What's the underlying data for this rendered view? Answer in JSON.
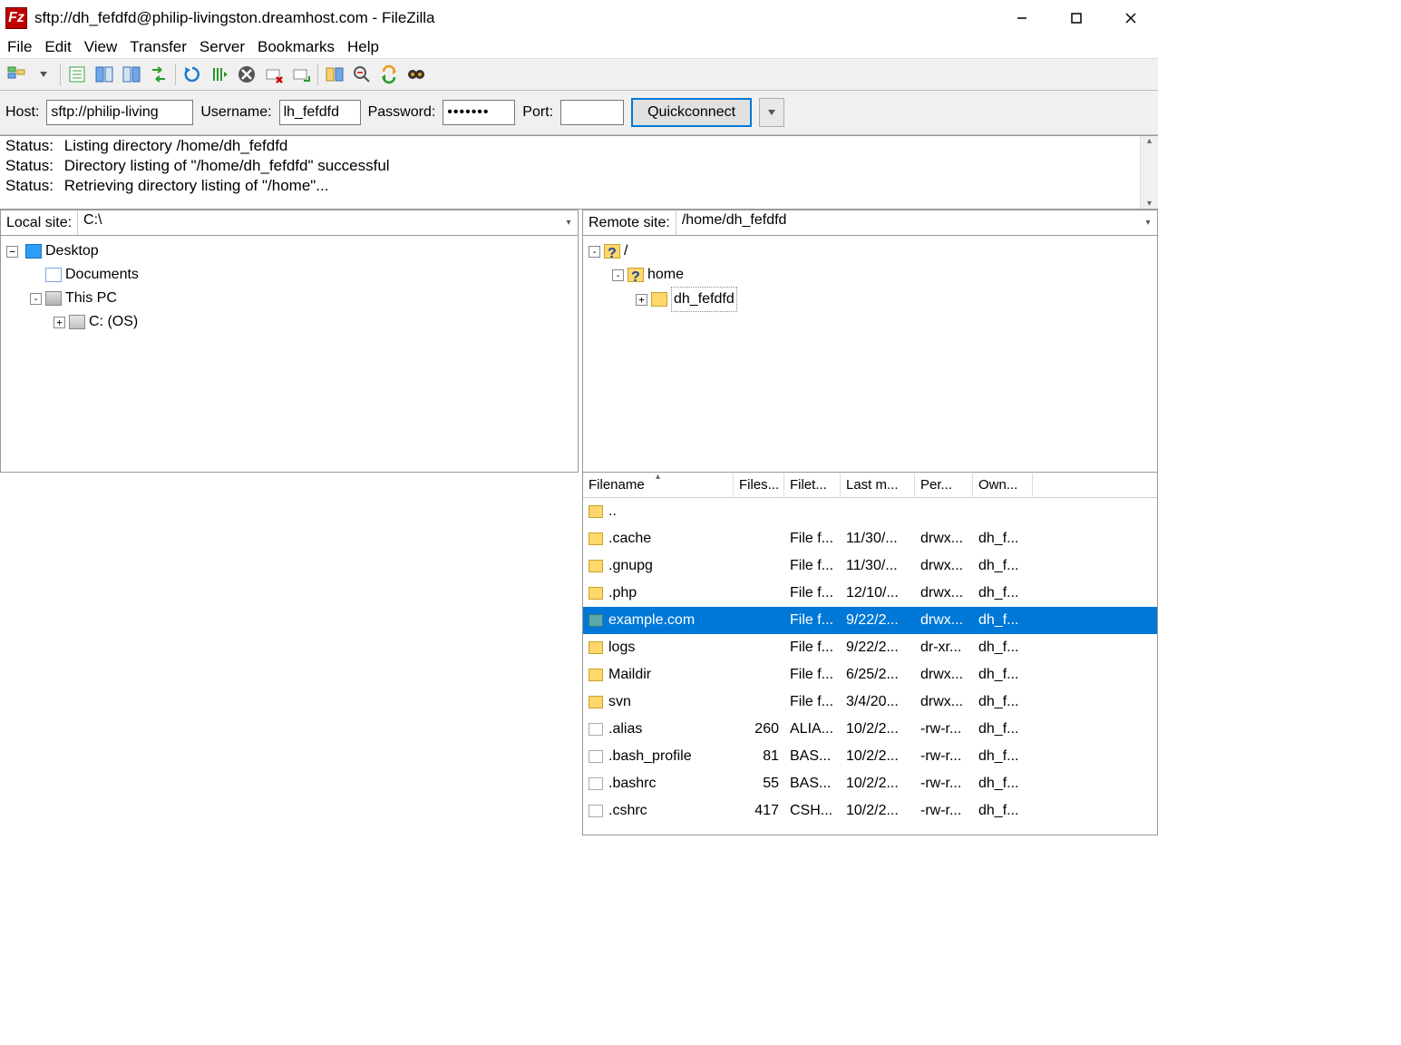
{
  "window": {
    "title": "sftp://dh_fefdfd@philip-livingston.dreamhost.com - FileZilla"
  },
  "menu": {
    "items": [
      "File",
      "Edit",
      "View",
      "Transfer",
      "Server",
      "Bookmarks",
      "Help"
    ]
  },
  "toolbar_icons": [
    "site-manager-icon",
    "dropdown-icon",
    "__sep",
    "toggle-log-icon",
    "toggle-local-tree-icon",
    "toggle-remote-tree-icon",
    "toggle-queue-icon",
    "__sep",
    "refresh-icon",
    "process-queue-icon",
    "cancel-icon",
    "disconnect-icon",
    "reconnect-icon",
    "__sep",
    "compare-icon",
    "filter-icon",
    "sync-browse-icon",
    "search-icon"
  ],
  "quickconnect": {
    "host_label": "Host:",
    "host_value": "sftp://philip-living",
    "user_label": "Username:",
    "user_value": "lh_fefdfd",
    "pass_label": "Password:",
    "pass_value": "•••••••",
    "port_label": "Port:",
    "port_value": "",
    "button": "Quickconnect"
  },
  "log": {
    "status_label": "Status:",
    "lines": [
      "Listing directory /home/dh_fefdfd",
      "Directory listing of \"/home/dh_fefdfd\" successful",
      "Retrieving directory listing of \"/home\"..."
    ]
  },
  "local": {
    "label": "Local site:",
    "path": "C:\\",
    "tree": {
      "desktop": "Desktop",
      "documents": "Documents",
      "thispc": "This PC",
      "drive": "C: (OS)"
    }
  },
  "remote": {
    "label": "Remote site:",
    "path": "/home/dh_fefdfd",
    "tree": {
      "root": "/",
      "home": "home",
      "user": "dh_fefdfd"
    }
  },
  "filelist": {
    "headers": {
      "name": "Filename",
      "size": "Files...",
      "type": "Filet...",
      "mod": "Last m...",
      "perm": "Per...",
      "own": "Own..."
    },
    "rows": [
      {
        "icon": "folder",
        "name": "..",
        "size": "",
        "type": "",
        "mod": "",
        "perm": "",
        "own": "",
        "sel": false
      },
      {
        "icon": "folder",
        "name": ".cache",
        "size": "",
        "type": "File f...",
        "mod": "11/30/...",
        "perm": "drwx...",
        "own": "dh_f...",
        "sel": false
      },
      {
        "icon": "folder",
        "name": ".gnupg",
        "size": "",
        "type": "File f...",
        "mod": "11/30/...",
        "perm": "drwx...",
        "own": "dh_f...",
        "sel": false
      },
      {
        "icon": "folder",
        "name": ".php",
        "size": "",
        "type": "File f...",
        "mod": "12/10/...",
        "perm": "drwx...",
        "own": "dh_f...",
        "sel": false
      },
      {
        "icon": "folder-sel",
        "name": "example.com",
        "size": "",
        "type": "File f...",
        "mod": "9/22/2...",
        "perm": "drwx...",
        "own": "dh_f...",
        "sel": true
      },
      {
        "icon": "folder",
        "name": "logs",
        "size": "",
        "type": "File f...",
        "mod": "9/22/2...",
        "perm": "dr-xr...",
        "own": "dh_f...",
        "sel": false
      },
      {
        "icon": "folder",
        "name": "Maildir",
        "size": "",
        "type": "File f...",
        "mod": "6/25/2...",
        "perm": "drwx...",
        "own": "dh_f...",
        "sel": false
      },
      {
        "icon": "folder",
        "name": "svn",
        "size": "",
        "type": "File f...",
        "mod": "3/4/20...",
        "perm": "drwx...",
        "own": "dh_f...",
        "sel": false
      },
      {
        "icon": "file",
        "name": ".alias",
        "size": "260",
        "type": "ALIA...",
        "mod": "10/2/2...",
        "perm": "-rw-r...",
        "own": "dh_f...",
        "sel": false
      },
      {
        "icon": "file",
        "name": ".bash_profile",
        "size": "81",
        "type": "BAS...",
        "mod": "10/2/2...",
        "perm": "-rw-r...",
        "own": "dh_f...",
        "sel": false
      },
      {
        "icon": "file",
        "name": ".bashrc",
        "size": "55",
        "type": "BAS...",
        "mod": "10/2/2...",
        "perm": "-rw-r...",
        "own": "dh_f...",
        "sel": false
      },
      {
        "icon": "file",
        "name": ".cshrc",
        "size": "417",
        "type": "CSH...",
        "mod": "10/2/2...",
        "perm": "-rw-r...",
        "own": "dh_f...",
        "sel": false
      }
    ]
  }
}
